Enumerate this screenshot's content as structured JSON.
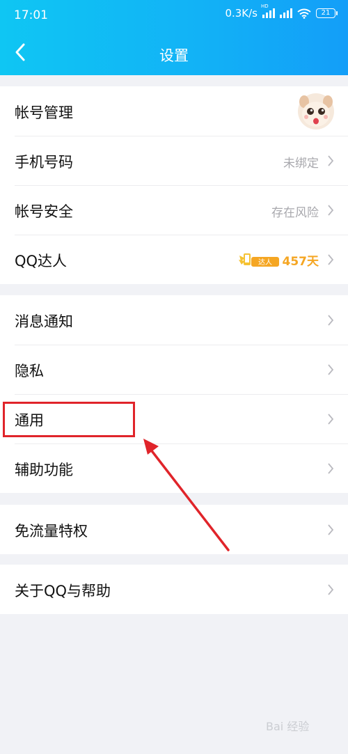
{
  "status_bar": {
    "time": "17:01",
    "net_speed": "0.3K/s",
    "hd_label": "HD",
    "battery": "21"
  },
  "nav": {
    "title": "设置"
  },
  "groups": [
    {
      "items": [
        {
          "label": "帐号管理"
        },
        {
          "label": "手机号码",
          "value": "未绑定"
        },
        {
          "label": "帐号安全",
          "value": "存在风险"
        },
        {
          "label": "QQ达人",
          "badge_text": "达人",
          "days": "457天"
        }
      ]
    },
    {
      "items": [
        {
          "label": "消息通知"
        },
        {
          "label": "隐私"
        },
        {
          "label": "通用"
        },
        {
          "label": "辅助功能"
        }
      ]
    },
    {
      "items": [
        {
          "label": "免流量特权"
        }
      ]
    },
    {
      "items": [
        {
          "label": "关于QQ与帮助"
        }
      ]
    }
  ],
  "colors": {
    "header_start": "#0fc6f3",
    "header_end": "#139ef8",
    "annotation": "#e0242a",
    "days_text": "#f5a623"
  },
  "annotation": {
    "target": "通用"
  },
  "watermark": {
    "text": "Bai 经验"
  }
}
